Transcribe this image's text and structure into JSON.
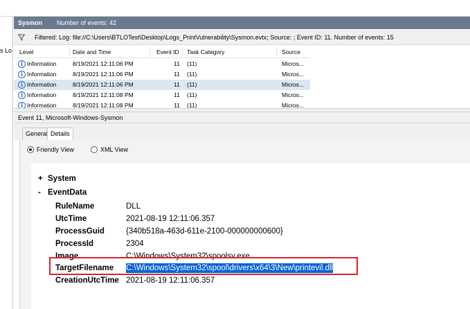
{
  "left_pane": {
    "partial_text": "s Lo"
  },
  "header": {
    "title": "Sysmon",
    "event_count": "Number of events: 42"
  },
  "filter_bar": {
    "icon": "funnel-icon",
    "text": "Filtered: Log: file://C:\\Users\\BTLOTest\\Desktop\\Logs_PrintVulnerability\\Sysmon.evtx; Source: ; Event ID: 11. Number of events: 15"
  },
  "table": {
    "columns": [
      "Level",
      "Date and Time",
      "Event ID",
      "Task Category",
      "Source"
    ],
    "rows": [
      {
        "level": "Information",
        "datetime": "8/19/2021 12:11:06 PM",
        "event_id": "11",
        "task_category": "(11)",
        "source": "Micros..."
      },
      {
        "level": "Information",
        "datetime": "8/19/2021 12:11:06 PM",
        "event_id": "11",
        "task_category": "(11)",
        "source": "Micros..."
      },
      {
        "level": "Information",
        "datetime": "8/19/2021 12:11:06 PM",
        "event_id": "11",
        "task_category": "(11)",
        "source": "Micros..."
      },
      {
        "level": "Information",
        "datetime": "8/19/2021 12:11:08 PM",
        "event_id": "11",
        "task_category": "(11)",
        "source": "Micros..."
      },
      {
        "level": "Information",
        "datetime": "8/19/2021 12:11:08 PM",
        "event_id": "11",
        "task_category": "(11)",
        "source": "Micros..."
      }
    ],
    "selected_row": 2
  },
  "event_title": "Event 11, Microsoft-Windows-Sysmon",
  "tabs": [
    "General",
    "Details"
  ],
  "view_options": {
    "friendly": "Friendly View",
    "xml": "XML View",
    "selected": "friendly"
  },
  "details": {
    "system_toggle": "+",
    "system_label": "System",
    "eventdata_toggle": "-",
    "eventdata_label": "EventData",
    "fields": [
      {
        "name": "RuleName",
        "value": "DLL"
      },
      {
        "name": "UtcTime",
        "value": "2021-08-19 12:11:06.357"
      },
      {
        "name": "ProcessGuid",
        "value": "{340b518a-463d-611e-2100-000000000600}"
      },
      {
        "name": "ProcessId",
        "value": "2304"
      },
      {
        "name": "Image",
        "value": "C:\\Windows\\System32\\spoolsv.exe"
      },
      {
        "name": "TargetFilename",
        "value": "C:\\Windows\\System32\\spool\\drivers\\x64\\3\\New\\printevil.dll"
      },
      {
        "name": "CreationUtcTime",
        "value": "2021-08-19 12:11:06.357"
      }
    ],
    "highlighted_field": "TargetFilename",
    "highlight_color": "#d9232a",
    "selection_color": "#0a64d6"
  }
}
